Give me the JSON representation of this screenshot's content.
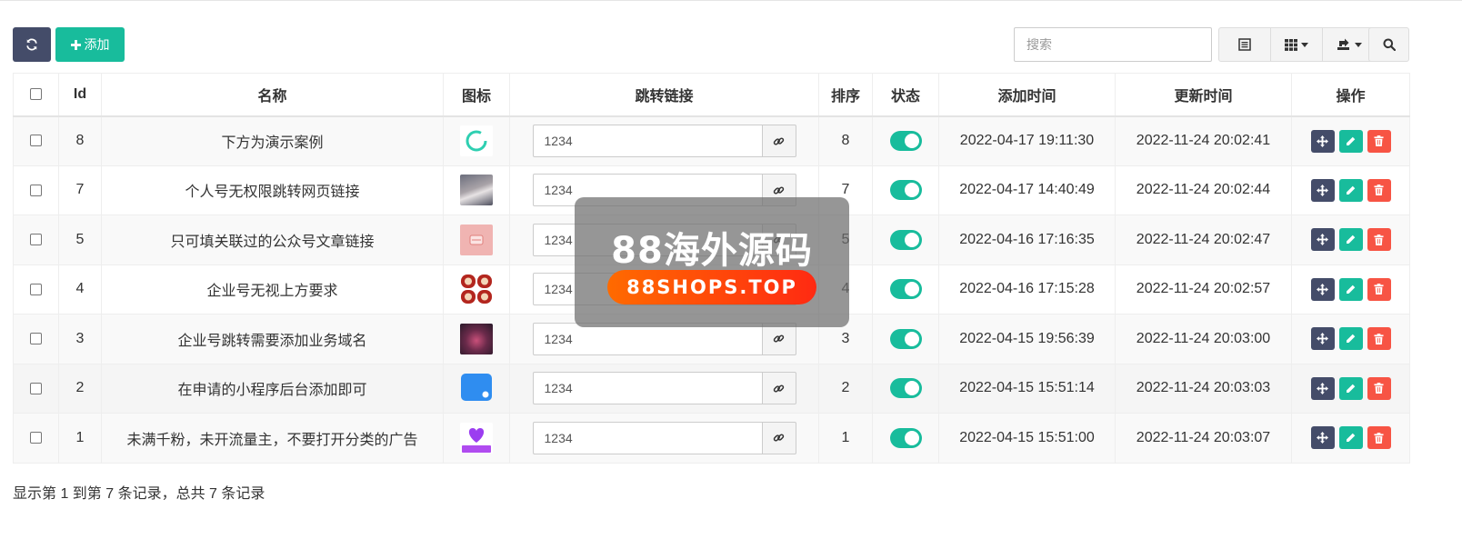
{
  "toolbar": {
    "refresh_icon": "refresh-icon",
    "add_label": "添加",
    "search_placeholder": "搜索"
  },
  "columns": [
    "Id",
    "名称",
    "图标",
    "跳转链接",
    "排序",
    "状态",
    "添加时间",
    "更新时间",
    "操作"
  ],
  "rows": [
    {
      "id": "8",
      "name": "下方为演示案例",
      "icon": "loading-ring-icon",
      "link": "1234",
      "sort": "8",
      "status": true,
      "created": "2022-04-17 19:11:30",
      "updated": "2022-11-24 20:02:41"
    },
    {
      "id": "7",
      "name": "个人号无权限跳转网页链接",
      "icon": "cat-photo-icon",
      "link": "1234",
      "sort": "7",
      "status": true,
      "created": "2022-04-17 14:40:49",
      "updated": "2022-11-24 20:02:44"
    },
    {
      "id": "5",
      "name": "只可填关联过的公众号文章链接",
      "icon": "pink-card-icon",
      "link": "1234",
      "sort": "5",
      "status": true,
      "created": "2022-04-16 17:16:35",
      "updated": "2022-11-24 20:02:47"
    },
    {
      "id": "4",
      "name": "企业号无视上方要求",
      "icon": "red-seal-icon",
      "link": "1234",
      "sort": "4",
      "status": true,
      "created": "2022-04-16 17:15:28",
      "updated": "2022-11-24 20:02:57"
    },
    {
      "id": "3",
      "name": "企业号跳转需要添加业务域名",
      "icon": "flower-photo-icon",
      "link": "1234",
      "sort": "3",
      "status": true,
      "created": "2022-04-15 19:56:39",
      "updated": "2022-11-24 20:03:00"
    },
    {
      "id": "2",
      "name": "在申请的小程序后台添加即可",
      "icon": "blue-chat-icon",
      "link": "1234",
      "sort": "2",
      "status": true,
      "created": "2022-04-15 15:51:14",
      "updated": "2022-11-24 20:03:03"
    },
    {
      "id": "1",
      "name": "未满千粉，未开流量主，不要打开分类的广告",
      "icon": "purple-heart-icon",
      "link": "1234",
      "sort": "1",
      "status": true,
      "created": "2022-04-15 15:51:00",
      "updated": "2022-11-24 20:03:07"
    }
  ],
  "footer": {
    "summary": "显示第 1 到第 7 条记录，总共 7 条记录"
  },
  "watermark": {
    "title": "88海外源码",
    "url": "88SHOPS.TOP"
  },
  "colors": {
    "primary": "#444c69",
    "success": "#18bc9c",
    "danger": "#f75444"
  }
}
